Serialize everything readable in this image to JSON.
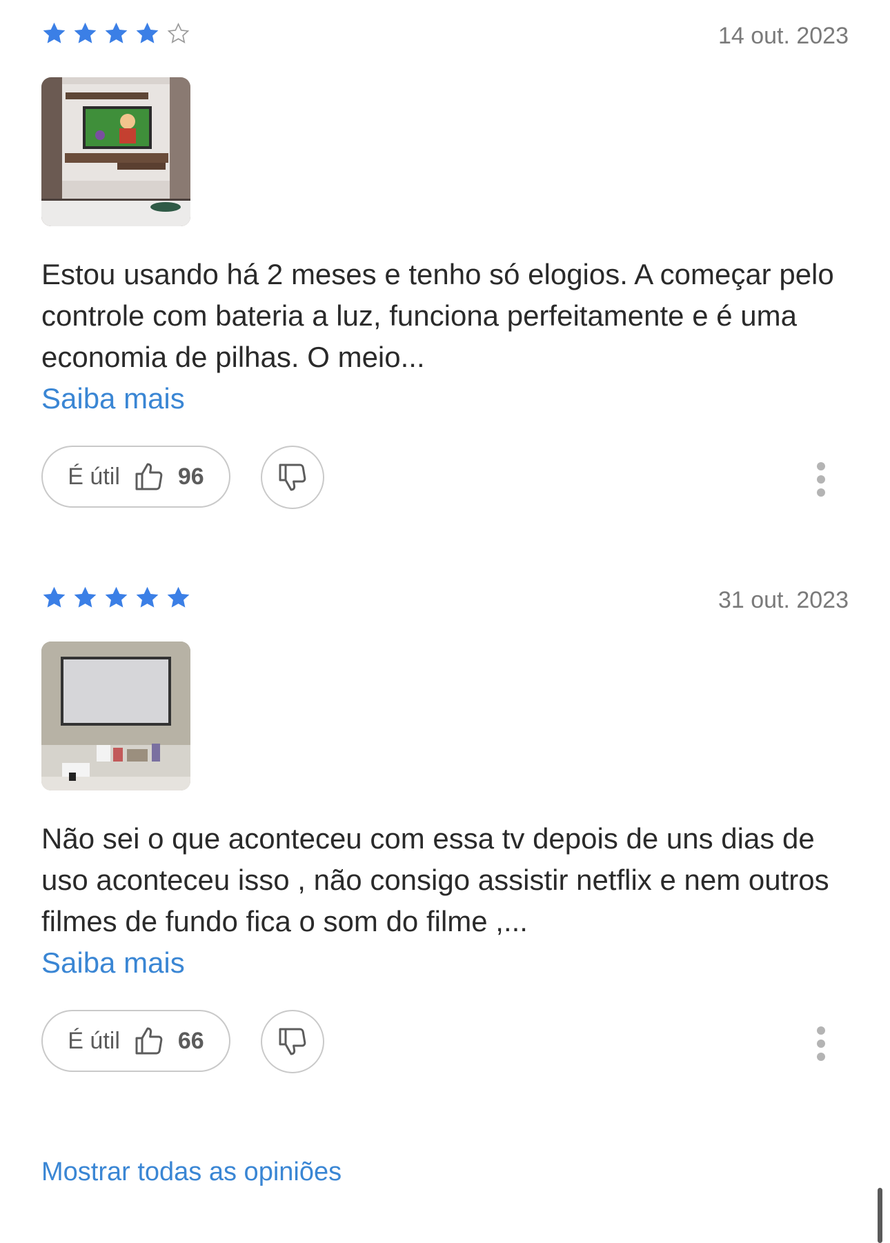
{
  "colors": {
    "star": "#3b7fe6",
    "link": "#3a86d4",
    "date": "#7a7a7a",
    "border": "#c9c9c9"
  },
  "reviews": [
    {
      "rating": 4,
      "max_rating": 5,
      "date": "14 out. 2023",
      "photo_icon": "tv-on-wall-photo",
      "text": "Estou usando há 2 meses e tenho só elogios. A começar pelo controle com bateria a luz, funciona perfeitamente e é uma economia de pilhas. O meio...",
      "more_label": "Saiba mais",
      "useful_label": "É útil",
      "useful_count": "96"
    },
    {
      "rating": 5,
      "max_rating": 5,
      "date": "31 out. 2023",
      "photo_icon": "tv-static-screen-photo",
      "text": "Não sei o que aconteceu com essa tv depois de uns dias de uso aconteceu isso , não consigo assistir netflix e nem outros filmes de fundo fica o som do filme ,...",
      "more_label": "Saiba mais",
      "useful_label": "É útil",
      "useful_count": "66"
    }
  ],
  "footer": {
    "show_all_label": "Mostrar todas as opiniões"
  }
}
